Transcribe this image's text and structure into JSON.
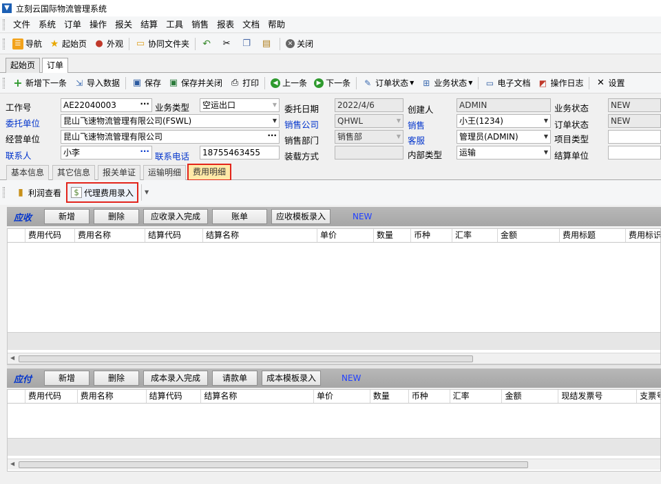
{
  "window": {
    "title": "立刻云国际物流管理系统"
  },
  "menu": [
    "文件",
    "系统",
    "订单",
    "操作",
    "报关",
    "结算",
    "工具",
    "销售",
    "报表",
    "文档",
    "帮助"
  ],
  "toolbar1": {
    "nav": "导航",
    "home": "起始页",
    "appearance": "外观",
    "shared": "协同文件夹",
    "close": "关闭"
  },
  "doc_tabs": [
    "起始页",
    "订单"
  ],
  "toolbar2": {
    "add_next": "新增下一条",
    "import": "导入数据",
    "save": "保存",
    "save_close": "保存并关闭",
    "print": "打印",
    "prev": "上一条",
    "next": "下一条",
    "order_status": "订单状态",
    "biz_status": "业务状态",
    "edoc": "电子文档",
    "log": "操作日志",
    "settings": "设置"
  },
  "form": {
    "job_no_label": "工作号",
    "job_no": "AE22040003",
    "biz_type_label": "业务类型",
    "biz_type": "空运出口",
    "entrust_date_label": "委托日期",
    "entrust_date": "2022/4/6",
    "creator_label": "创建人",
    "creator": "ADMIN",
    "biz_status_label": "业务状态",
    "biz_status": "NEW",
    "client_label": "委托单位",
    "client": "昆山飞速物流管理有限公司(FSWL)",
    "sales_co_label": "销售公司",
    "sales_co": "QHWL",
    "sales_label": "销售",
    "sales": "小王(1234)",
    "order_status_label": "订单状态",
    "order_status": "NEW",
    "operator_label": "经营单位",
    "operator": "昆山飞速物流管理有限公司",
    "sales_dept_label": "销售部门",
    "sales_dept": "销售部",
    "cs_label": "客服",
    "cs": "管理员(ADMIN)",
    "project_label": "项目类型",
    "project": "",
    "contact_label": "联系人",
    "contact": "小李",
    "phone_label": "联系电话",
    "phone": "18755463455",
    "load_label": "装载方式",
    "load": "",
    "internal_label": "内部类型",
    "internal": "运输",
    "settle_label": "结算单位",
    "settle": ""
  },
  "sub_tabs": [
    "基本信息",
    "其它信息",
    "报关单证",
    "运输明细",
    "费用明细"
  ],
  "subtool": {
    "profit": "利润查看",
    "agent_fee": "代理费用录入"
  },
  "receivable": {
    "title": "应收",
    "buttons": [
      "新增",
      "删除",
      "应收录入完成",
      "账单",
      "应收模板录入"
    ],
    "status": "NEW",
    "columns": [
      "费用代码",
      "费用名称",
      "结算代码",
      "结算名称",
      "单价",
      "数量",
      "币种",
      "汇率",
      "金额",
      "费用标题",
      "费用标识"
    ]
  },
  "payable": {
    "title": "应付",
    "buttons": [
      "新增",
      "删除",
      "成本录入完成",
      "请款单",
      "成本模板录入"
    ],
    "status": "NEW",
    "columns": [
      "费用代码",
      "费用名称",
      "结算代码",
      "结算名称",
      "单价",
      "数量",
      "币种",
      "汇率",
      "金额",
      "现结发票号",
      "支票号"
    ]
  },
  "colors": {
    "accent_red": "#e2231a",
    "label_blue": "#0033cc",
    "active_subtab": "#ffe9a8"
  }
}
